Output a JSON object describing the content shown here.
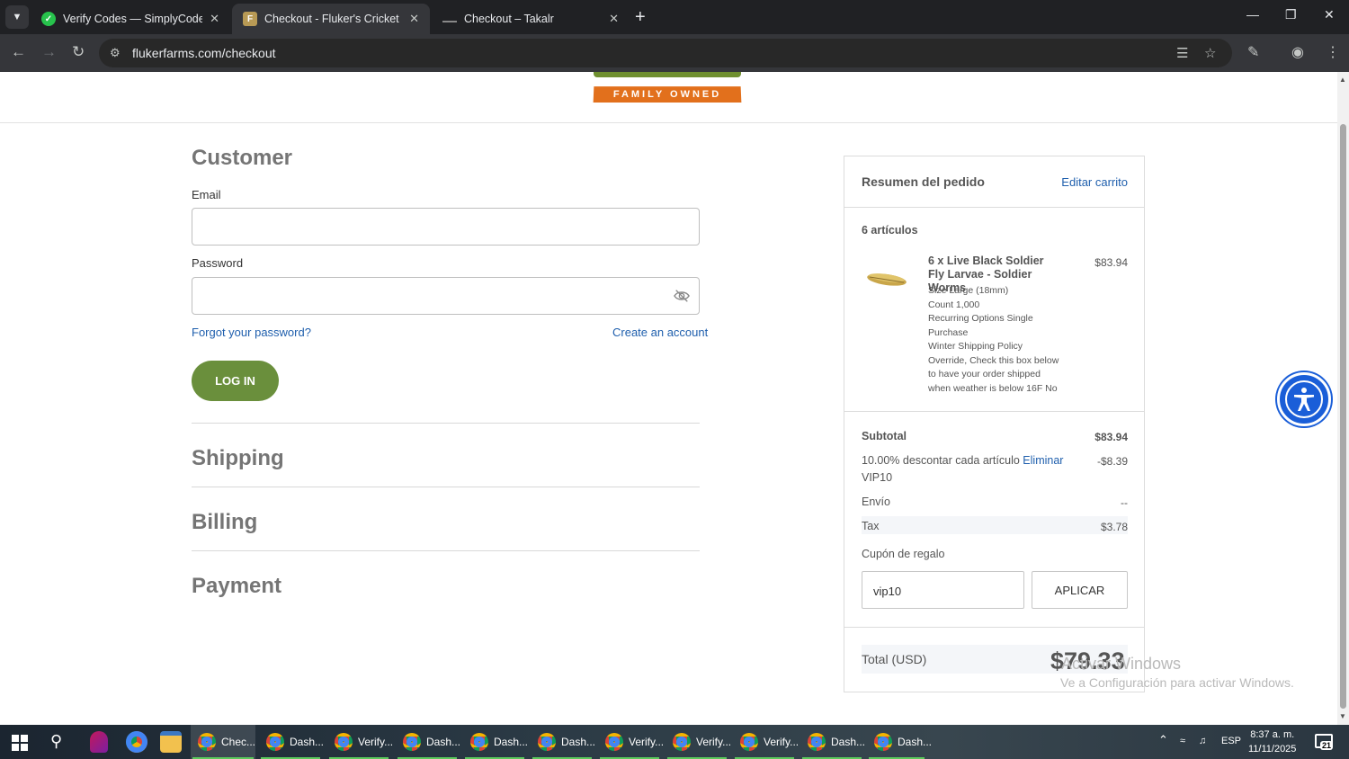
{
  "browser": {
    "tabs": [
      {
        "title": "Verify Codes — SimplyCodes",
        "active": false
      },
      {
        "title": "Checkout - Fluker's Cricket Farm",
        "active": true
      },
      {
        "title": "Checkout – Takalr",
        "active": false
      }
    ],
    "url": "flukerfarms.com/checkout"
  },
  "brand": {
    "tagline": "FAMILY OWNED",
    "colors": {
      "green": "#6a8f3c",
      "orange": "#e2701c",
      "link": "#1f5fad"
    }
  },
  "customer": {
    "heading": "Customer",
    "email_label": "Email",
    "email_value": "",
    "password_label": "Password",
    "password_value": "",
    "forgot_link": "Forgot your password?",
    "create_link": "Create an account",
    "login_button": "LOG IN"
  },
  "sections": {
    "shipping": "Shipping",
    "billing": "Billing",
    "payment": "Payment"
  },
  "summary": {
    "title": "Resumen del pedido",
    "edit_cart": "Editar carrito",
    "item_count": "6 artículos",
    "product": {
      "name": "6 x Live Black Soldier Fly Larvae - Soldier Worms",
      "price": "$83.94",
      "options": [
        "Size Large (18mm)",
        "Count 1,000",
        "Recurring Options Single Purchase",
        "Winter Shipping Policy Override, Check this box below to have your order shipped when weather is below 16F No"
      ]
    },
    "subtotal_label": "Subtotal",
    "subtotal_value": "$83.94",
    "discount_label": "10.00% descontar cada artículo",
    "discount_remove": "Eliminar",
    "discount_code": "VIP10",
    "discount_value": "-$8.39",
    "shipping_label": "Envío",
    "shipping_value": "--",
    "tax_label": "Tax",
    "tax_value": "$3.78",
    "gift_label": "Cupón de regalo",
    "coupon_value": "vip10",
    "apply_button": "APLICAR",
    "total_label": "Total (USD)",
    "total_value": "$79.33"
  },
  "watermark": {
    "line1": "Activar Windows",
    "line2": "Ve a Configuración para activar Windows."
  },
  "taskbar": {
    "items": [
      "Chec...",
      "Dash...",
      "Verify...",
      "Dash...",
      "Dash...",
      "Dash...",
      "Verify...",
      "Verify...",
      "Verify...",
      "Dash...",
      "Dash..."
    ],
    "language": "ESP",
    "time": "8:37 a. m.",
    "date": "11/11/2025",
    "notifications": "21"
  }
}
